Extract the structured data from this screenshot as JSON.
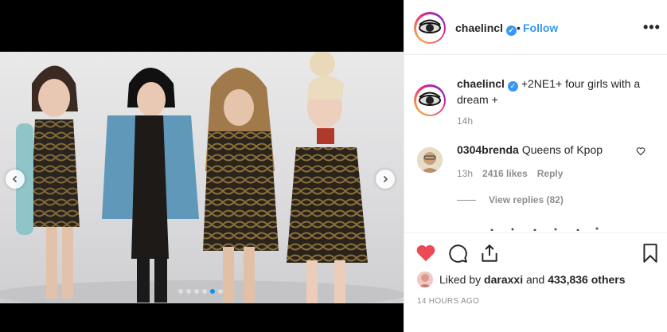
{
  "post": {
    "username": "chaelincl",
    "follow_label": "Follow",
    "separator": "•",
    "more_label": "•••"
  },
  "caption": {
    "username": "chaelincl",
    "text": "+2NE1+ four girls with a dream +",
    "time": "14h"
  },
  "comment": {
    "username": "0304brenda",
    "text": "Queens of Kpop",
    "time": "13h",
    "likes": "2416 likes",
    "reply_label": "Reply",
    "view_replies": "View replies (82)"
  },
  "likes": {
    "prefix": "Liked by",
    "liker": "daraxxi",
    "middle": "and",
    "count": "433,836 others"
  },
  "timestamp": "14 HOURS AGO",
  "carousel": {
    "slides": 6,
    "active_index": 4
  },
  "colors": {
    "accent": "#3897f0",
    "like_red": "#ed4956",
    "muted": "#8e8e8e",
    "text": "#262626"
  },
  "icons": [
    "verified-icon",
    "more-icon",
    "heart-icon",
    "comment-icon",
    "share-icon",
    "bookmark-icon",
    "chevron-left-icon",
    "chevron-right-icon"
  ]
}
